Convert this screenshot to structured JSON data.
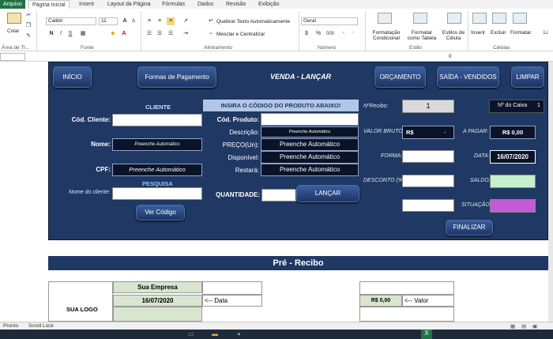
{
  "ribbon": {
    "tabs": [
      "Arquivo",
      "Página Inicial",
      "Inserir",
      "Layout da Página",
      "Fórmulas",
      "Dados",
      "Revisão",
      "Exibição"
    ],
    "clipboard": {
      "paste_label": "Colar",
      "group_label": "Área de Tr..."
    },
    "font": {
      "name": "Calibri",
      "size": "11",
      "group_label": "Fonte",
      "bold": "N",
      "italic": "I",
      "underline": "S",
      "grow": "A",
      "shrink": "A"
    },
    "alignment": {
      "wrap_text": "Quebrar Texto Automaticamente",
      "merge_center": "Mesclar e Centralizar",
      "group_label": "Alinhamento"
    },
    "number": {
      "format": "Geral",
      "percent": "%",
      "thousands": "000",
      "group_label": "Número"
    },
    "styles": {
      "conditional": "Formatação Condicional",
      "as_table": "Formatar como Tabela",
      "cell_styles": "Estilos de Célula",
      "group_label": "Estilo"
    },
    "cells": {
      "insert": "Inserir",
      "delete": "Excluir",
      "format": "Formatar",
      "group_label": "Células"
    },
    "edit_cut": "Li"
  },
  "sheet": {
    "top_cell_value": "0",
    "nav": {
      "inicio": "INÍCIO",
      "formas_pagamento": "Formas de Pagamento",
      "title": "VENDA - LANÇAR",
      "orcamento": "ORÇAMENTO",
      "saida_vendidos": "SAÍDA - VENDIDOS",
      "limpar": "LIMPAR"
    },
    "cliente": {
      "section": "CLIENTE",
      "cod_label": "Cód. Cliente:",
      "nome_label": "Nome:",
      "nome_value": "Preenche Automático",
      "cpf_label": "CPF:",
      "cpf_value": "Preenche Automático",
      "pesquisa": "PESQUISA",
      "nome_cliente_label": "Nome do cliente:",
      "ver_codigo": "Ver Código"
    },
    "produto": {
      "header": "INSIRA O CÓDIGO DO PRODUTO ABAIXO!",
      "cod_label": "Cód. Produto:",
      "descricao_label": "Descrição:",
      "descricao_value": "Preenche Automático",
      "preco_label": "PREÇO(Un):",
      "preco_value": "Preenche Automático",
      "disponivel_label": "Disponível:",
      "disponivel_value": "Preenche Automático",
      "restara_label": "Restará:",
      "restara_value": "Preenche Automático",
      "quantidade_label": "QUANTIDADE:",
      "lancar": "LANÇAR"
    },
    "venda": {
      "recibo_label": "NºRecibo:",
      "recibo_value": "1",
      "caixa_label": "Nº do Caixa",
      "caixa_value": "1",
      "valor_bruto_label": "VALOR BRUTO:",
      "valor_bruto_currency": "R$",
      "valor_bruto_value": "-",
      "a_pagar_label": "A PAGAR:",
      "a_pagar_value": "R$ 0,00",
      "forma_label": "FORMA:",
      "data_label": "DATA:",
      "data_value": "16/07/2020",
      "desconto_label": "DESCONTO (%):",
      "saldo_label": "SALDO:",
      "situacao_label": "SITUAÇÃO:",
      "finalizar": "FINALIZAR"
    },
    "recibo": {
      "title": "Pré - Recibo",
      "empresa": "Sua Empresa",
      "logo": "SUA LOGO",
      "data_value": "16/07/2020",
      "data_label": "<-- Data",
      "valor_value": "R$ 0,00",
      "valor_label": "<-- Valor"
    }
  },
  "status": {
    "ready": "Pronto",
    "scroll_lock": "Scroll Lock"
  },
  "colors": {
    "panel": "#1f3864",
    "accent_green": "#c6efce",
    "accent_purple": "#c45bd6",
    "excel_green": "#217346"
  }
}
